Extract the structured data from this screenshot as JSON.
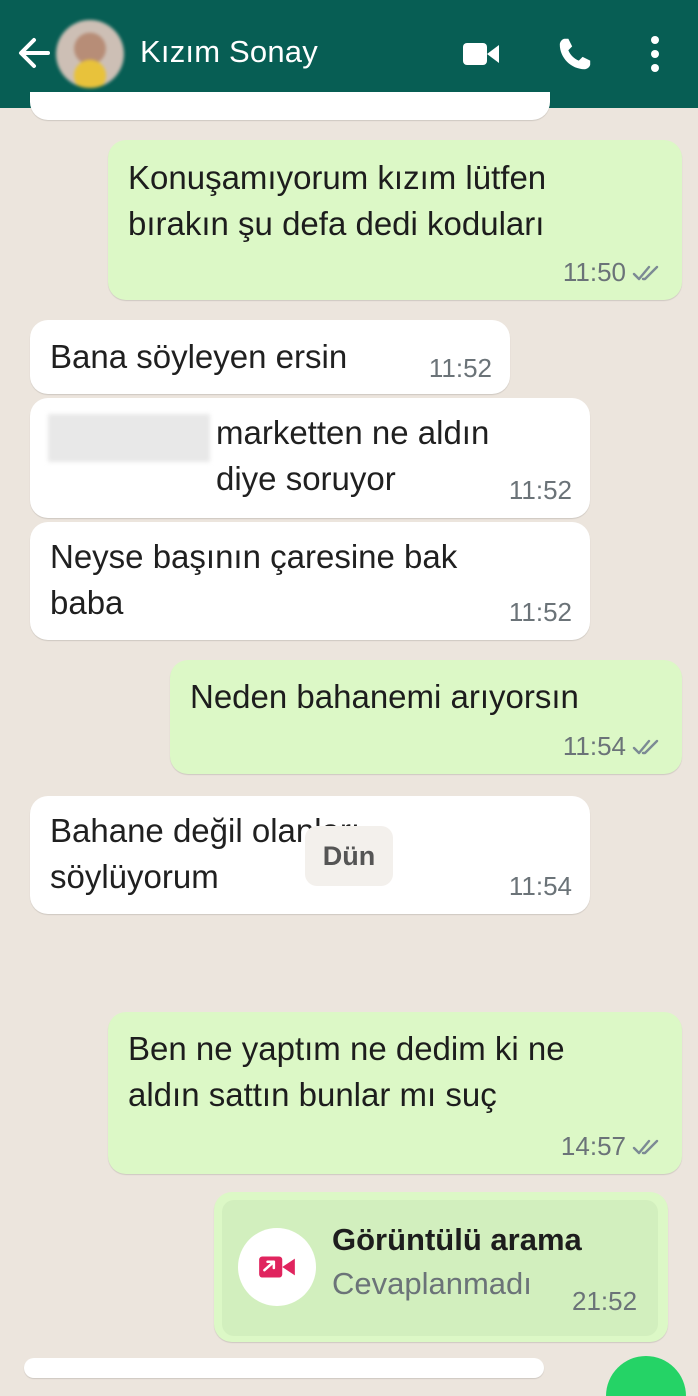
{
  "header": {
    "contact_name": "Kızım Sonay"
  },
  "messages": [
    {
      "dir": "out",
      "text": "Konuşamıyorum kızım lütfen\nbırakın şu defa dedi koduları",
      "time": "11:50"
    },
    {
      "dir": "in",
      "text": "Bana söyleyen ersin",
      "time": "11:52"
    },
    {
      "dir": "in",
      "text": "marketten ne aldın\ndiye soruyor",
      "time": "11:52"
    },
    {
      "dir": "in",
      "text": "Neyse başının çaresine bak\nbaba",
      "time": "11:52"
    },
    {
      "dir": "out",
      "text": "Neden bahanemi arıyorsın",
      "time": "11:54"
    },
    {
      "dir": "in",
      "text": "Bahane değil olanları\nsöylüyorum",
      "time": "11:54"
    },
    {
      "dir": "out",
      "text": "Ben ne yaptım ne dedim ki ne\naldın sattın bunlar mı suç",
      "time": "14:57"
    }
  ],
  "day_separator": "Dün",
  "call": {
    "title": "Görüntülü arama",
    "status": "Cevaplanmadı",
    "time": "21:52"
  },
  "colors": {
    "header": "#075e54",
    "background": "#ece5dd",
    "outgoing": "#dcf8c6",
    "incoming": "#ffffff",
    "missed_call": "#e0245e"
  },
  "icons": [
    "back-arrow-icon",
    "video-call-icon",
    "phone-icon",
    "more-vert-icon",
    "read-ticks-icon",
    "missed-video-call-icon"
  ]
}
